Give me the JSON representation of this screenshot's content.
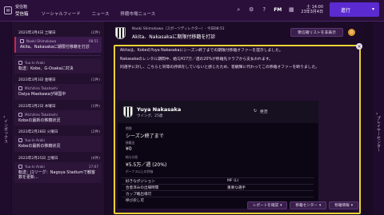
{
  "topbar": {
    "section": "受信箱",
    "tab_active": "受信箱",
    "nav": [
      "ソーシャルフィード",
      "ニュース",
      "移籍市場ニュース"
    ],
    "fm_label": "FM",
    "date_time": "土 14:00",
    "date": "23年3月4日",
    "continue_label": "進行",
    "icons": [
      "search-icon",
      "settings-icon",
      "help-icon",
      "fm-logo"
    ]
  },
  "left_rail": {
    "label": "インボックス"
  },
  "right_rail": {
    "label": "プレイヤーセンター"
  },
  "inbox": {
    "groups": [
      {
        "date": "2023年3月4日 土曜日",
        "count": "(2件)",
        "messages": [
          {
            "from": "Naoki Shimokawa",
            "time": "08:51",
            "subject": "Akita、Nakasakaに期限付移籍を打診",
            "sub": ""
          },
          {
            "from": "Yuu-in Araki",
            "time": "",
            "subject": "転送：Kobe、G-Osakaに対決",
            "sub": ""
          }
        ]
      },
      {
        "date": "2023年3月3日 金曜日",
        "count": "(1件)",
        "messages": [
          {
            "from": "Michihiro Takahashi",
            "time": "",
            "subject": "Daiya Maekawaが帰国中",
            "sub": ""
          }
        ]
      },
      {
        "date": "2023年3月2日 木曜日",
        "count": "(1件)",
        "messages": [
          {
            "from": "Michihiro Takahashi",
            "time": "",
            "subject": "Kobeの最新の移籍状況",
            "sub": ""
          }
        ]
      },
      {
        "date": "2023年2月28日 火曜日",
        "count": "(2件)",
        "messages": [
          {
            "from": "Yuu-in Araki",
            "time": "",
            "subject": "Kobeの最新の移籍状況",
            "sub": ""
          }
        ]
      },
      {
        "date": "2023年2月25日 土曜日",
        "count": "(4件)",
        "messages": [
          {
            "from": "Yuu-in Araki",
            "time": "17:07",
            "subject": "転送：J1リーグ：Nagoya Stadiumで観客数を更新...",
            "sub": ""
          }
        ]
      }
    ]
  },
  "message": {
    "sender_line": "Naoki Shimokawa（スポーツディレクター）- 今日08:51",
    "title": "Akita、Nakasakaに期限付移籍を打診",
    "add_list_label": "受信箱リストを非表示",
    "coin_label": "0",
    "paragraphs": [
      "Akitaは、KobeのYuya Nakasakaにシーズン終了までの期限付移籍オファーを提示しました。",
      "Nakasakaのレンタル期間中、給与¥27万／週の20%が移籍先クラブから支払われます。",
      "同選手に対し、こちらと同等の評価をしていないと感じたため、客観陣に代わってこの移籍オファーを断りました。"
    ],
    "player": {
      "name": "Yuya Nakasaka",
      "position": "ウイング、25歳",
      "status": "拒否",
      "fields": [
        {
          "label": "期間",
          "value": "シーズン終了まで"
        },
        {
          "label": "移籍金",
          "value": "¥0"
        },
        {
          "label": "給与分担",
          "value": "¥5.5万／週 (20%)"
        }
      ],
      "attrs_header": "ボーナス以上の評価",
      "attrs": [
        {
          "k": "好きなポジション",
          "v": "MF (L)"
        },
        {
          "k": "合意済みの出場時間",
          "v": "重要な選手"
        },
        {
          "k": "カップ戦出場可",
          "v": ""
        },
        {
          "k": "呼び戻し可",
          "v": ""
        }
      ]
    },
    "buttons": [
      "レポートを確認",
      "移籍センター",
      "移籍情報"
    ]
  }
}
